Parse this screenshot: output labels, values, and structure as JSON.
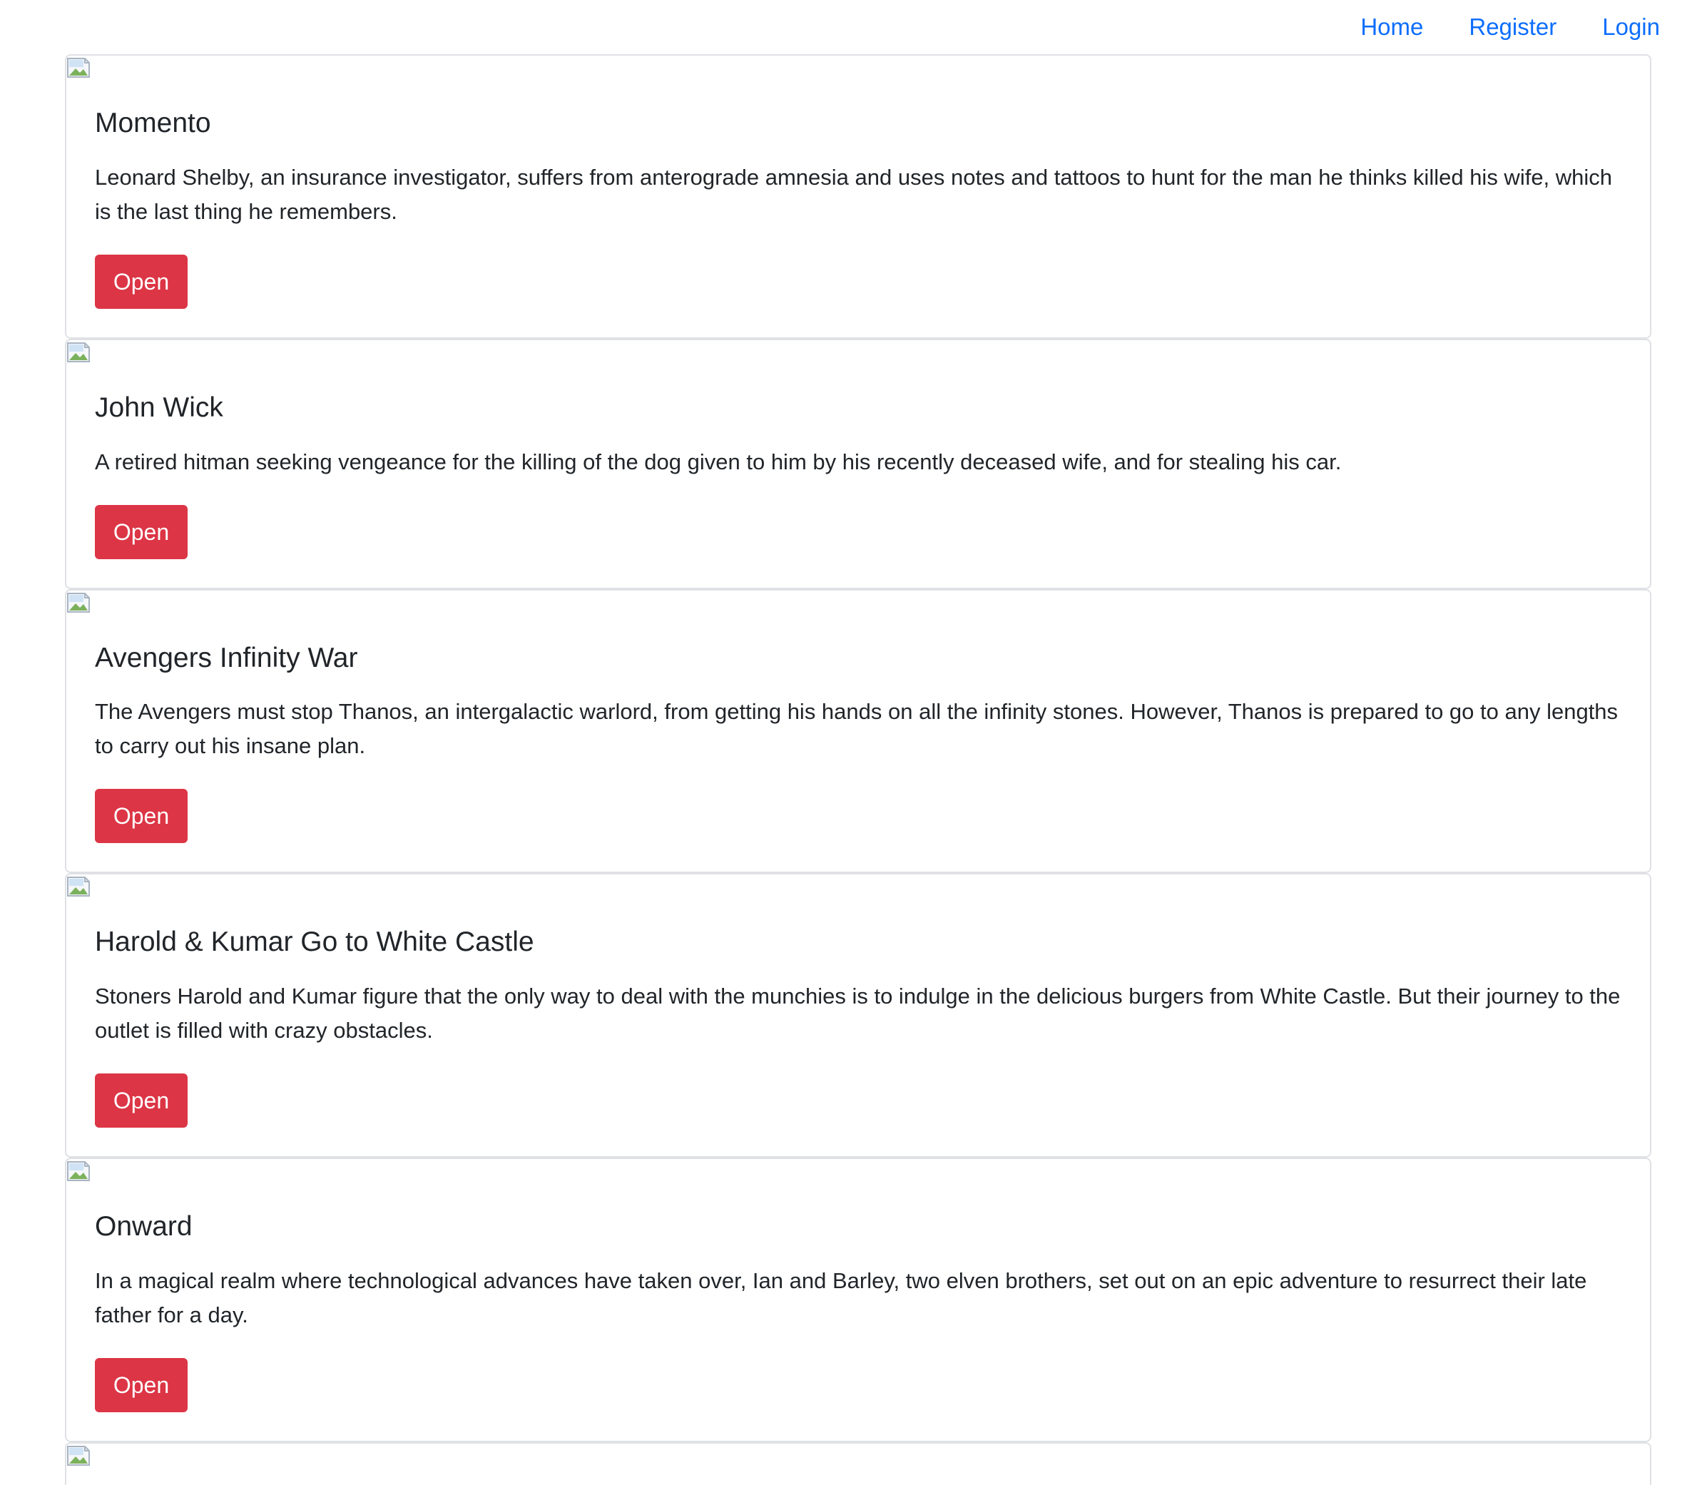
{
  "nav": {
    "home": "Home",
    "register": "Register",
    "login": "Login"
  },
  "colors": {
    "link": "#0d6efd",
    "button": "#dc3545",
    "border": "#dfe1e5",
    "text": "#212529"
  },
  "movies": [
    {
      "title": "Momento",
      "description": "Leonard Shelby, an insurance investigator, suffers from anterograde amnesia and uses notes and tattoos to hunt for the man he thinks killed his wife, which is the last thing he remembers.",
      "button": "Open"
    },
    {
      "title": "John Wick",
      "description": "A retired hitman seeking vengeance for the killing of the dog given to him by his recently deceased wife, and for stealing his car.",
      "button": "Open"
    },
    {
      "title": "Avengers Infinity War",
      "description": "The Avengers must stop Thanos, an intergalactic warlord, from getting his hands on all the infinity stones. However, Thanos is prepared to go to any lengths to carry out his insane plan.",
      "button": "Open"
    },
    {
      "title": "Harold & Kumar Go to White Castle",
      "description": "Stoners Harold and Kumar figure that the only way to deal with the munchies is to indulge in the delicious burgers from White Castle. But their journey to the outlet is filled with crazy obstacles.",
      "button": "Open"
    },
    {
      "title": "Onward",
      "description": "In a magical realm where technological advances have taken over, Ian and Barley, two elven brothers, set out on an epic adventure to resurrect their late father for a day.",
      "button": "Open"
    }
  ]
}
